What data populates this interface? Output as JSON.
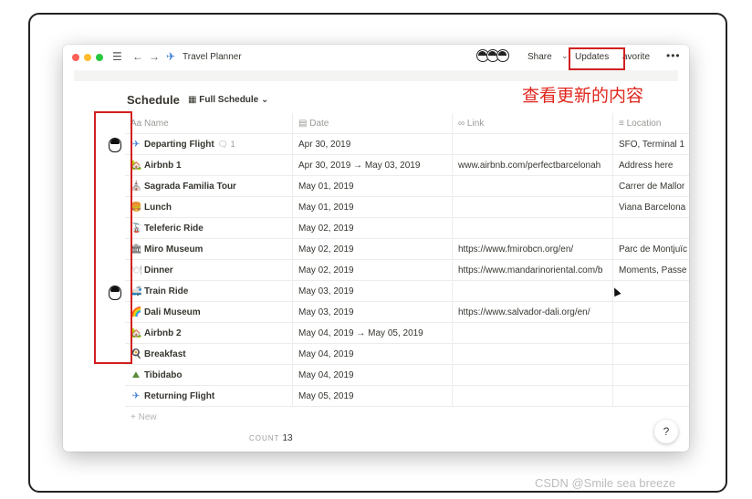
{
  "window": {
    "title": "Travel Planner",
    "title_icon": "airplane-icon",
    "share_label": "Share",
    "updates_label": "Updates",
    "favorite_label": "avorite",
    "more_label": "•••"
  },
  "database": {
    "title": "Schedule",
    "view_label": "Full Schedule"
  },
  "table": {
    "columns": [
      {
        "label": "Name",
        "icon": "text-icon"
      },
      {
        "label": "Date",
        "icon": "calendar-icon"
      },
      {
        "label": "Link",
        "icon": "link-icon"
      },
      {
        "label": "Location",
        "icon": "list-icon"
      }
    ],
    "rows": [
      {
        "icon": "✈",
        "color": "#3b7bd6",
        "name": "Departing Flight",
        "comments": "1",
        "date": "Apr 30, 2019",
        "link": "",
        "location": "SFO, Terminal 1"
      },
      {
        "icon": "🏡",
        "color": "#d48a2b",
        "name": "Airbnb 1",
        "comments": "",
        "date": "Apr 30, 2019 → May 03, 2019",
        "link": "www.airbnb.com/perfectbarcelonah",
        "location": "Address here"
      },
      {
        "icon": "⛪",
        "color": "#8a6a4a",
        "name": "Sagrada Familia Tour",
        "comments": "",
        "date": "May 01, 2019",
        "link": "",
        "location": "Carrer de Mallor"
      },
      {
        "icon": "🍔",
        "color": "#d4862b",
        "name": "Lunch",
        "comments": "",
        "date": "May 01, 2019",
        "link": "",
        "location": "Viana Barcelona"
      },
      {
        "icon": "🚡",
        "color": "#666666",
        "name": "Teleferic Ride",
        "comments": "",
        "date": "May 02, 2019",
        "link": "",
        "location": ""
      },
      {
        "icon": "🏛",
        "color": "#333333",
        "name": "Miro Museum",
        "comments": "",
        "date": "May 02, 2019",
        "link": "https://www.fmirobcn.org/en/",
        "location": "Parc de Montjuïc"
      },
      {
        "icon": "🍽",
        "color": "#aaaaaa",
        "name": "Dinner",
        "comments": "",
        "date": "May 02, 2019",
        "link": "https://www.mandarinoriental.com/b",
        "location": "Moments, Passe"
      },
      {
        "icon": "🚅",
        "color": "#4a7bb0",
        "name": "Train Ride",
        "comments": "",
        "date": "May 03, 2019",
        "link": "",
        "location": ""
      },
      {
        "icon": "🌈",
        "color": "#d46a2b",
        "name": "Dali Museum",
        "comments": "",
        "date": "May 03, 2019",
        "link": "https://www.salvador-dali.org/en/",
        "location": ""
      },
      {
        "icon": "🏡",
        "color": "#d48a2b",
        "name": "Airbnb 2",
        "comments": "",
        "date": "May 04, 2019 → May 05, 2019",
        "link": "",
        "location": ""
      },
      {
        "icon": "🍳",
        "color": "#c4552b",
        "name": "Breakfast",
        "comments": "",
        "date": "May 04, 2019",
        "link": "",
        "location": ""
      },
      {
        "icon": "⛰",
        "color": "#5a8a3a",
        "name": "Tibidabo",
        "comments": "",
        "date": "May 04, 2019",
        "link": "",
        "location": ""
      },
      {
        "icon": "✈",
        "color": "#3b7bd6",
        "name": "Returning Flight",
        "comments": "",
        "date": "May 05, 2019",
        "link": "",
        "location": ""
      }
    ],
    "new_label": "+ New",
    "count_label": "COUNT",
    "count_value": "13"
  },
  "help_label": "?",
  "annotation": {
    "label": "查看更新的内容",
    "color": "#d21f1f"
  },
  "watermark": "CSDN @Smile sea breeze"
}
